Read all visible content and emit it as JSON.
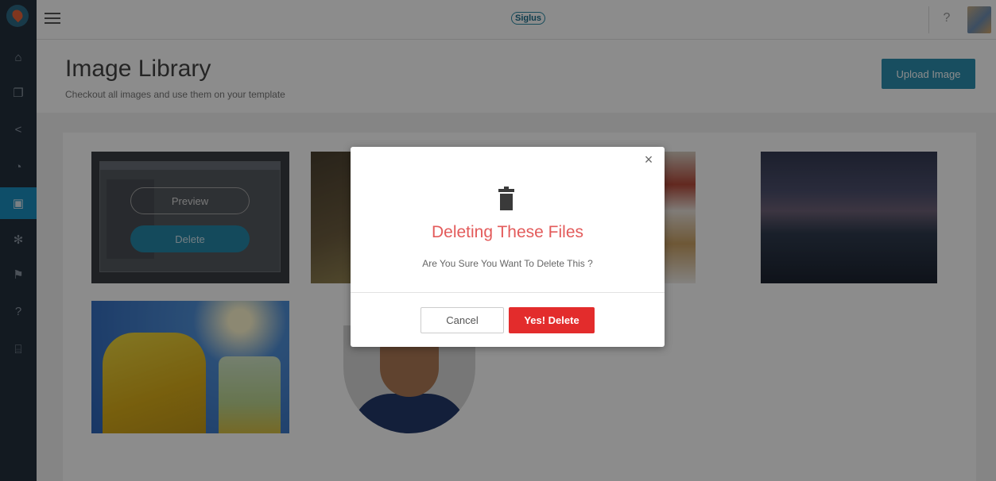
{
  "topbar": {
    "brand": "Siglus",
    "help_label": "?"
  },
  "sidebar": {
    "items": [
      {
        "icon": "home-icon",
        "glyph": "⌂"
      },
      {
        "icon": "copy-icon",
        "glyph": "❐"
      },
      {
        "icon": "share-icon",
        "glyph": "<"
      },
      {
        "icon": "pie-chart-icon",
        "glyph": "◔"
      },
      {
        "icon": "image-icon",
        "glyph": "▣"
      },
      {
        "icon": "gear-icon",
        "glyph": "✻"
      },
      {
        "icon": "signpost-icon",
        "glyph": "⚑"
      },
      {
        "icon": "help-icon",
        "glyph": "?"
      },
      {
        "icon": "gift-icon",
        "glyph": "⌸"
      }
    ]
  },
  "header": {
    "title": "Image Library",
    "subtitle": "Checkout all images and use them on your template",
    "upload_label": "Upload Image"
  },
  "gallery": {
    "preview_label": "Preview",
    "delete_label": "Delete"
  },
  "modal": {
    "close_glyph": "×",
    "title": "Deleting These Files",
    "message": "Are You Sure You Want To Delete This ?",
    "cancel_label": "Cancel",
    "confirm_label": "Yes! Delete"
  },
  "colors": {
    "sidebar_bg": "#24303d",
    "accent": "#2c8fb0",
    "danger": "#e32c2c",
    "modal_title": "#e35b5b"
  }
}
